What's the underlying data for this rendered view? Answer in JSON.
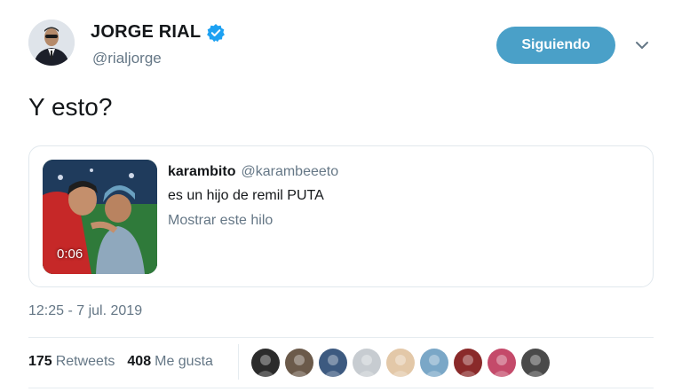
{
  "user": {
    "display_name": "JORGE RIAL",
    "handle": "@rialjorge",
    "follow_label": "Siguiendo"
  },
  "tweet": {
    "text": "Y esto?",
    "timestamp": "12:25 - 7 jul. 2019"
  },
  "quote": {
    "name": "karambito",
    "handle": "@karambeeeto",
    "text": "es un hijo de remil PUTA",
    "show_thread": "Mostrar este hilo",
    "video_duration": "0:06"
  },
  "stats": {
    "retweets_count": "175",
    "retweets_label": "Retweets",
    "likes_count": "408",
    "likes_label": "Me gusta"
  },
  "likers": [
    {
      "color": "#2b2b2b"
    },
    {
      "color": "#6b5a4a"
    },
    {
      "color": "#3d5a80"
    },
    {
      "color": "#c7ccd1"
    },
    {
      "color": "#e3c8a8"
    },
    {
      "color": "#7aa7c7"
    },
    {
      "color": "#8a2a2a"
    },
    {
      "color": "#c44a6a"
    },
    {
      "color": "#4a4a4a"
    }
  ],
  "colors": {
    "accent": "#4aa0c8",
    "verified": "#1da1f2",
    "muted": "#657786"
  }
}
